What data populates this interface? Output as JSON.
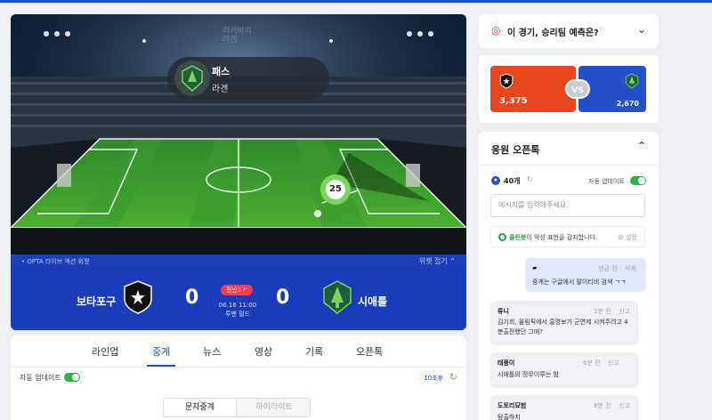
{
  "widget": {
    "ghost_line1": "라커바리",
    "ghost_line2": "라겐",
    "pass_label": "패스",
    "pass_player": "라겐",
    "marker_number": "25",
    "opta_text": "• OPTA 라이브 액션 위젯",
    "fold_label": "위젯 접기 ⌃"
  },
  "scoreboard": {
    "home_team": "보타포구",
    "away_team": "시애틀",
    "home_score": "0",
    "away_score": "0",
    "half": "전반17'",
    "date": "06.16 11:00",
    "round": "루멘 필드"
  },
  "tabs": {
    "items": [
      "라인업",
      "중계",
      "뉴스",
      "영상",
      "기록",
      "오픈톡"
    ],
    "active": "중계"
  },
  "auto_update": {
    "label": "자동 업데이트",
    "countdown": "10초후",
    "refresh_icon": "refresh-icon"
  },
  "subtabs": {
    "first": "문자중계",
    "second": "하이라이트"
  },
  "predict": {
    "title": "이 경기, 승리팀 예측은?",
    "home_votes": "3,375",
    "away_votes": "2,670",
    "vs": "VS"
  },
  "chat": {
    "title": "응원 오픈톡",
    "count": "40개",
    "auto_update": "자동 업데이트",
    "placeholder": "메시지를 입력해주세요.",
    "cleanbot_name": "클린봇",
    "cleanbot_text": "이 악성 표현을 감지합니다.",
    "settings": "설정",
    "messages": [
      {
        "nick": "",
        "time": "방금 전",
        "action": "삭제",
        "text": "중계는 구글에서 말이티비 검색 ㄱㄱ",
        "mine": true
      },
      {
        "nick": "류니",
        "time": "1분 전",
        "action": "신고",
        "text": "김기희, 올림픽에서 홍명보가 군면제 시켜주려고 4분출전했던 그애?"
      },
      {
        "nick": "태풍이",
        "time": "6분 전",
        "action": "신고",
        "text": "시애틀의 장무이루는 밤"
      },
      {
        "nick": "도토리묘범",
        "time": "8분 전",
        "action": "신고",
        "text": "탐출하지"
      }
    ]
  },
  "colors": {
    "accent": "#1f4fc9",
    "home": "#e8461f",
    "away": "#2451c9",
    "live": "#ff3b4c",
    "toggle": "#27b34a"
  }
}
